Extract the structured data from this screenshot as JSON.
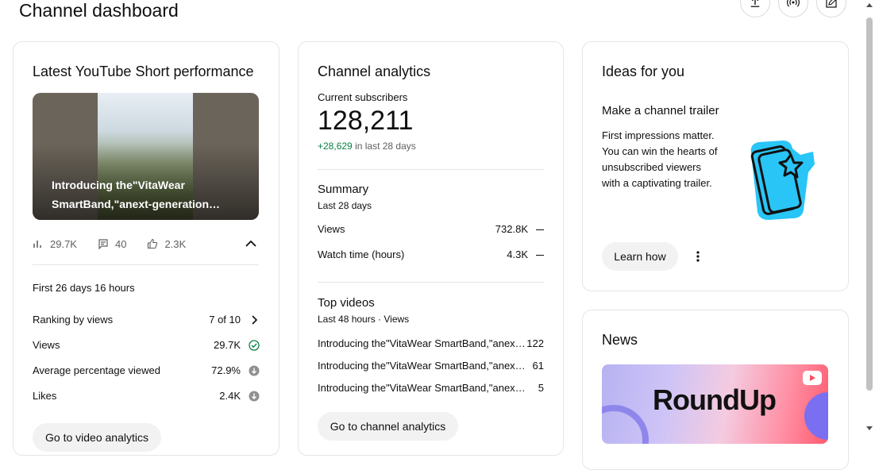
{
  "header": {
    "title": "Channel dashboard",
    "actions": [
      {
        "name": "upload-icon"
      },
      {
        "name": "go-live-icon"
      },
      {
        "name": "create-post-icon"
      }
    ]
  },
  "short_card": {
    "title": "Latest YouTube Short performance",
    "thumb_line1": "Introducing the\"VitaWear",
    "thumb_line2": "SmartBand,\"anext-generation…",
    "views": "29.7K",
    "comments": "40",
    "likes": "2.3K",
    "period": "First 26 days 16 hours",
    "rows": [
      {
        "label": "Ranking by views",
        "value": "7 of 10",
        "icon": "chevron-right-icon"
      },
      {
        "label": "Views",
        "value": "29.7K",
        "icon": "check-circle-icon"
      },
      {
        "label": "Average percentage viewed",
        "value": "72.9%",
        "icon": "arrow-down-circle-icon"
      },
      {
        "label": "Likes",
        "value": "2.4K",
        "icon": "arrow-down-circle-icon"
      }
    ],
    "button": "Go to video analytics"
  },
  "analytics_card": {
    "title": "Channel analytics",
    "subscribers_label": "Current subscribers",
    "subscribers_value": "128,211",
    "subscribers_delta": "+28,629",
    "subscribers_delta_suffix": "in last 28 days",
    "summary_title": "Summary",
    "summary_period": "Last 28 days",
    "summary_rows": [
      {
        "label": "Views",
        "value": "732.8K"
      },
      {
        "label": "Watch time (hours)",
        "value": "4.3K"
      }
    ],
    "top_title": "Top videos",
    "top_period": "Last 48 hours · Views",
    "top_rows": [
      {
        "label": "Introducing the\"VitaWear SmartBand,\"anex…",
        "value": "122"
      },
      {
        "label": "Introducing the\"VitaWear SmartBand,\"anex…",
        "value": "61"
      },
      {
        "label": "Introducing the\"VitaWear SmartBand,\"anex…",
        "value": "5"
      }
    ],
    "button": "Go to channel analytics"
  },
  "ideas_card": {
    "title": "Ideas for you",
    "idea_title": "Make a channel trailer",
    "idea_line1": "First impressions matter.",
    "idea_line2": "You can win the hearts of",
    "idea_line3": "unsubscribed viewers",
    "idea_line4": "with a captivating trailer.",
    "button": "Learn how"
  },
  "news_card": {
    "title": "News",
    "banner_text": "RoundUp"
  },
  "colors": {
    "accent_cyan": "#29c5f6",
    "delta_green": "#0b8043"
  }
}
